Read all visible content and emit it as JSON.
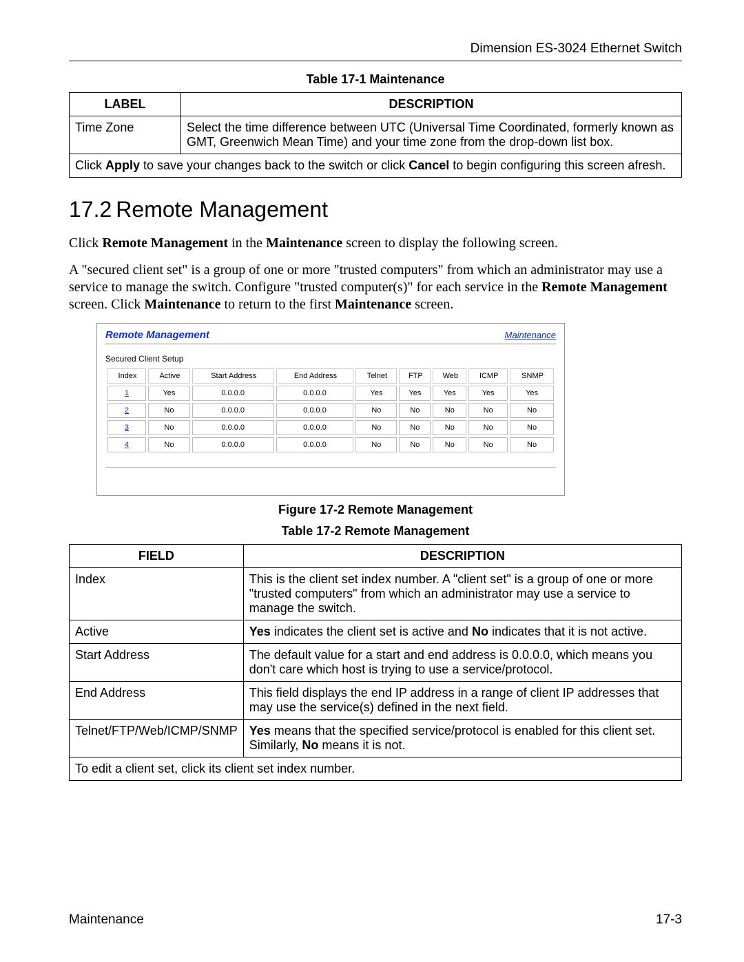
{
  "header": {
    "right": "Dimension ES-3024 Ethernet Switch"
  },
  "table1": {
    "caption": "Table 17-1 Maintenance",
    "head": {
      "label": "LABEL",
      "desc": "DESCRIPTION"
    },
    "rows": [
      {
        "label": "Time Zone",
        "desc": "Select the time difference between UTC (Universal Time Coordinated, formerly known as GMT, Greenwich Mean Time) and your time zone from the drop-down list box."
      }
    ],
    "span_pre": "Click ",
    "span_b1": "Apply",
    "span_mid": " to save your changes back to the switch or click ",
    "span_b2": "Cancel",
    "span_post": " to begin configuring this screen afresh."
  },
  "section": {
    "num": "17.2",
    "title": "Remote Management"
  },
  "p1": {
    "pre": "Click ",
    "b1": "Remote Management",
    "mid": " in the ",
    "b2": "Maintenance",
    "post": " screen to display the following screen."
  },
  "p2": {
    "t1": "A \"secured client set\" is a group of one or more \"trusted computers\" from which an administrator may use a service to manage the switch. Configure \"trusted computer(s)\" for each service in the ",
    "b1": "Remote Management",
    "t2": " screen. Click ",
    "b2": "Maintenance",
    "t3": " to return to the first ",
    "b3": "Maintenance",
    "t4": " screen."
  },
  "screenshot": {
    "title": "Remote Management",
    "link": "Maintenance",
    "subtitle": "Secured Client Setup",
    "cols": [
      "Index",
      "Active",
      "Start Address",
      "End Address",
      "Telnet",
      "FTP",
      "Web",
      "ICMP",
      "SNMP"
    ],
    "rows": [
      {
        "idx": "1",
        "active": "Yes",
        "start": "0.0.0.0",
        "end": "0.0.0.0",
        "telnet": "Yes",
        "ftp": "Yes",
        "web": "Yes",
        "icmp": "Yes",
        "snmp": "Yes"
      },
      {
        "idx": "2",
        "active": "No",
        "start": "0.0.0.0",
        "end": "0.0.0.0",
        "telnet": "No",
        "ftp": "No",
        "web": "No",
        "icmp": "No",
        "snmp": "No"
      },
      {
        "idx": "3",
        "active": "No",
        "start": "0.0.0.0",
        "end": "0.0.0.0",
        "telnet": "No",
        "ftp": "No",
        "web": "No",
        "icmp": "No",
        "snmp": "No"
      },
      {
        "idx": "4",
        "active": "No",
        "start": "0.0.0.0",
        "end": "0.0.0.0",
        "telnet": "No",
        "ftp": "No",
        "web": "No",
        "icmp": "No",
        "snmp": "No"
      }
    ]
  },
  "fig_caption": "Figure 17-2 Remote Management",
  "table2": {
    "caption": "Table 17-2 Remote Management",
    "head": {
      "field": "FIELD",
      "desc": "DESCRIPTION"
    },
    "rows": [
      {
        "field": "Index",
        "desc": "This is the client set index number. A \"client set\" is a group of one or more \"trusted computers\" from which an administrator may use a service to manage the switch."
      },
      {
        "field": "Active",
        "pre": "",
        "b1": "Yes",
        "mid": " indicates the client set is active and ",
        "b2": "No",
        "post": " indicates that it is not active."
      },
      {
        "field": "Start Address",
        "desc": "The default value for a start and end address is 0.0.0.0, which means you don't care which host is trying to use a service/protocol."
      },
      {
        "field": "End Address",
        "desc": "This field displays the end IP address in a range of client IP addresses that may use the service(s) defined in the next field."
      },
      {
        "field": "Telnet/FTP/Web/ICMP/SNMP",
        "b1": "Yes",
        "mid": " means that the specified service/protocol is enabled for this client set. Similarly, ",
        "b2": "No",
        "post": " means it is not."
      }
    ],
    "span": "To edit a client set, click its client set index number."
  },
  "footer": {
    "left": "Maintenance",
    "right": "17-3"
  }
}
